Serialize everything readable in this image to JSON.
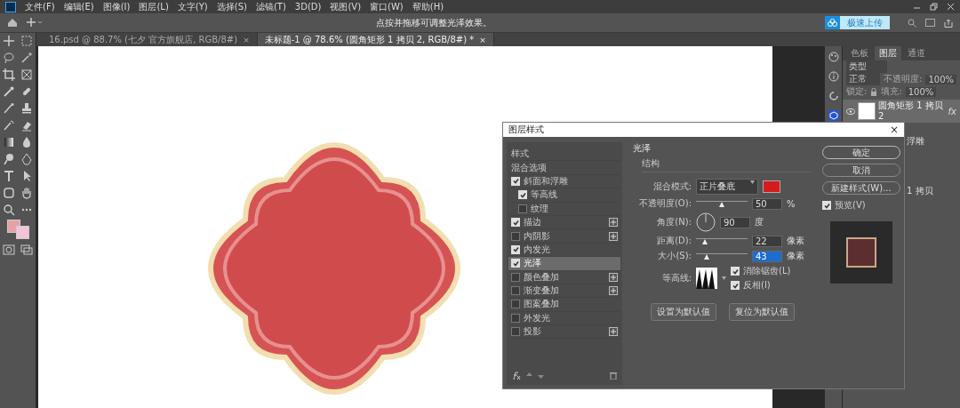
{
  "menu": [
    "文件(F)",
    "编辑(E)",
    "图像(I)",
    "图层(L)",
    "文字(Y)",
    "选择(S)",
    "滤镜(T)",
    "3D(D)",
    "视图(V)",
    "窗口(W)",
    "帮助(H)"
  ],
  "options_bar": {
    "hint": "点按并拖移可调整光泽效果。",
    "upload_button": "极速上传"
  },
  "document_tabs": [
    {
      "label": "16.psd @ 88.7% (七夕 官方旗舰店, RGB/8#)",
      "close": "×",
      "selected": false
    },
    {
      "label": "未标题-1 @ 78.6% (圆角矩形 1 拷贝 2, RGB/8#) *",
      "close": "×",
      "selected": true
    }
  ],
  "layers_panel": {
    "tabs": [
      {
        "label": "色板",
        "selected": false
      },
      {
        "label": "图层",
        "selected": true
      },
      {
        "label": "通道",
        "selected": false
      }
    ],
    "filter_placeholder": "类型",
    "blend_mode": "正常",
    "opacity_label": "不透明度:",
    "opacity": "100%",
    "lock_label": "锁定:",
    "fill_label": "填充:",
    "fill": "100%",
    "layers": [
      {
        "name": "圆角矩形 1 拷贝 2",
        "visible": true,
        "fx": "fx"
      }
    ],
    "partial_texts": [
      "浮雕",
      "1 拷贝"
    ]
  },
  "dialog": {
    "title": "图层样式",
    "close": "×",
    "styles": [
      {
        "label": "样式",
        "kind": "header",
        "selected": false
      },
      {
        "label": "混合选项",
        "kind": "header",
        "selected": false
      },
      {
        "label": "斜面和浮雕",
        "kind": "effect",
        "checked": true,
        "selected": false,
        "addable": false,
        "children": [
          {
            "label": "等高线",
            "checked": true
          },
          {
            "label": "纹理",
            "checked": false
          }
        ]
      },
      {
        "label": "描边",
        "kind": "effect",
        "checked": true,
        "selected": false,
        "addable": true
      },
      {
        "label": "内阴影",
        "kind": "effect",
        "checked": false,
        "selected": false,
        "addable": true
      },
      {
        "label": "内发光",
        "kind": "effect",
        "checked": true,
        "selected": false,
        "addable": false
      },
      {
        "label": "光泽",
        "kind": "effect",
        "checked": true,
        "selected": true,
        "addable": false
      },
      {
        "label": "颜色叠加",
        "kind": "effect",
        "checked": false,
        "selected": false,
        "addable": true
      },
      {
        "label": "渐变叠加",
        "kind": "effect",
        "checked": false,
        "selected": false,
        "addable": true
      },
      {
        "label": "图案叠加",
        "kind": "effect",
        "checked": false,
        "selected": false,
        "addable": false
      },
      {
        "label": "外发光",
        "kind": "effect",
        "checked": false,
        "selected": false,
        "addable": false
      },
      {
        "label": "投影",
        "kind": "effect",
        "checked": false,
        "selected": false,
        "addable": true
      }
    ],
    "section": "光泽",
    "group": "结构",
    "fields": [
      {
        "kind": "select",
        "label": "混合模式:",
        "value": "正片叠底",
        "color": "#d41c1c"
      },
      {
        "kind": "slider",
        "label": "不透明度(O):",
        "level": 0.5,
        "value": "50",
        "unit": "%",
        "focused": false
      },
      {
        "kind": "angle",
        "label": "角度(N):",
        "value": "90",
        "unit": "度"
      },
      {
        "kind": "slider",
        "label": "距离(D):",
        "level": 0.17,
        "value": "22",
        "unit": "像素",
        "focused": false
      },
      {
        "kind": "slider",
        "label": "大小(S):",
        "level": 0.2,
        "value": "43",
        "unit": "像素",
        "focused": true
      },
      {
        "kind": "contour",
        "label": "等高线:",
        "options": [
          {
            "label": "消除锯齿(L)",
            "checked": true
          },
          {
            "label": "反相(I)",
            "checked": true
          }
        ]
      }
    ],
    "default_buttons": [
      "设置为默认值",
      "复位为默认值"
    ],
    "buttons": [
      "确定",
      "取消",
      "新建样式(W)..."
    ],
    "preview": {
      "label": "预览(V)",
      "checked": true
    }
  }
}
